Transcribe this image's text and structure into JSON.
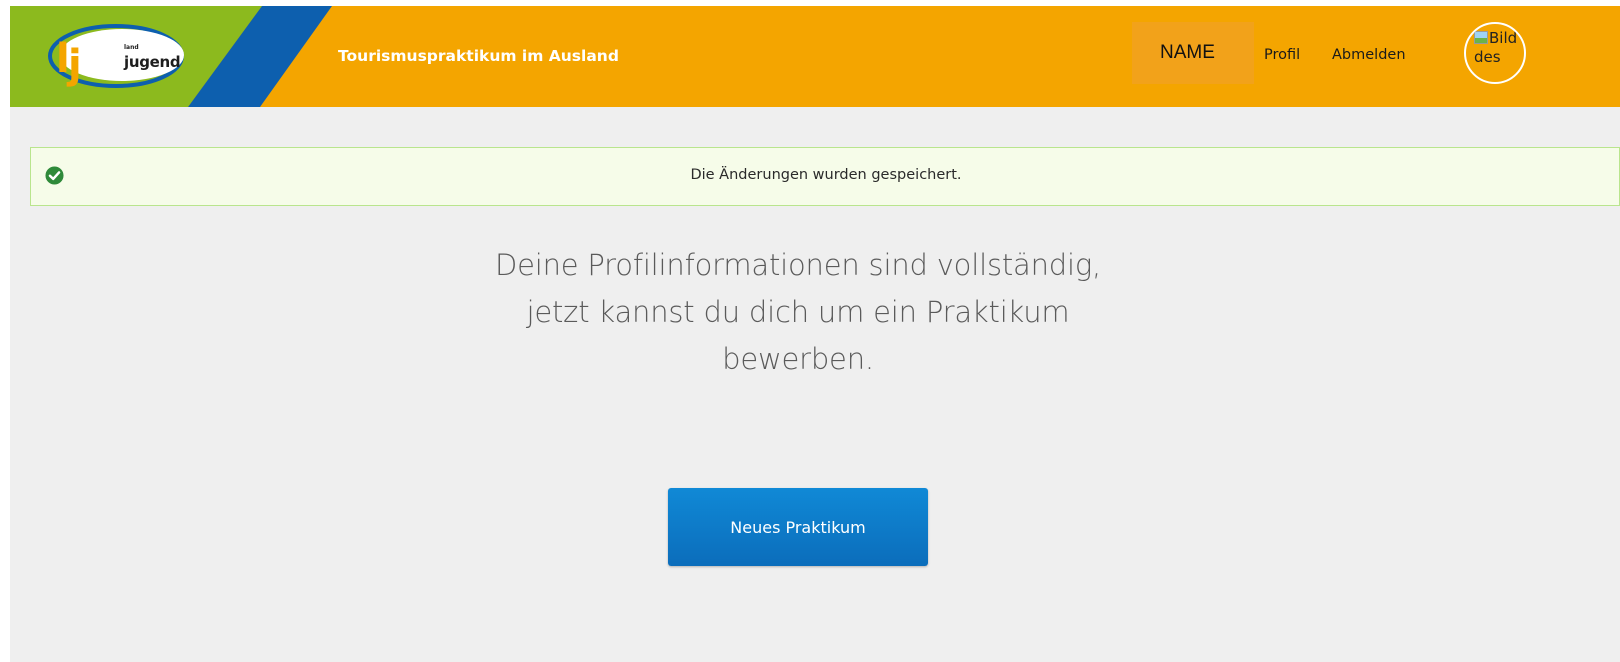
{
  "colors": {
    "header_orange": "#f4a500",
    "logo_green": "#8cba1e",
    "logo_blue": "#0d5fae",
    "alert_border": "#b9e58d",
    "alert_bg": "#f6fce9",
    "button_blue": "#0b73c4"
  },
  "header": {
    "logo_small": "land",
    "logo_text": "jugend",
    "app_title": "Tourismuspraktikum im Ausland",
    "user_name": "NAME",
    "profile_link": "Profil",
    "logout_link": "Abmelden",
    "avatar_alt": "Bild des",
    "avatar_icon": "broken-image-icon"
  },
  "alert": {
    "icon": "check-circle-icon",
    "text": "Die Änderungen wurden gespeichert."
  },
  "main": {
    "message_lines": [
      "Deine Profilinformationen sind vollständig,",
      "jetzt kannst du dich um ein Praktikum",
      "bewerben."
    ],
    "new_button_label": "Neues Praktikum"
  }
}
